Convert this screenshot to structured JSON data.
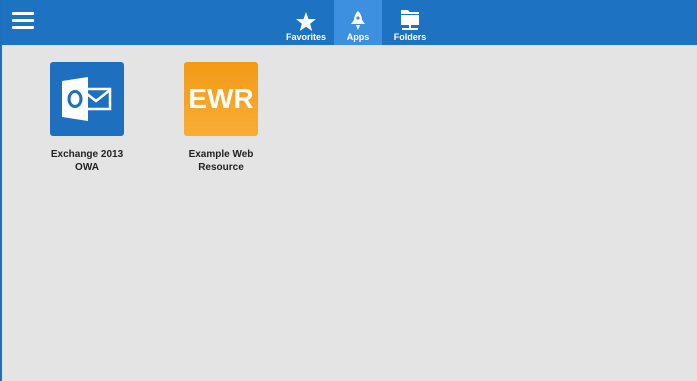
{
  "header": {
    "menu_icon": "hamburger-menu-icon",
    "tabs": [
      {
        "id": "favorites",
        "label": "Favorites",
        "icon": "star-icon",
        "active": false
      },
      {
        "id": "apps",
        "label": "Apps",
        "icon": "rocket-icon",
        "active": true
      },
      {
        "id": "folders",
        "label": "Folders",
        "icon": "folder-icon",
        "active": false
      }
    ]
  },
  "apps": [
    {
      "label_line1": "Exchange 2013",
      "label_line2": "OWA",
      "icon": "outlook-icon",
      "color": "#1f6fbf"
    },
    {
      "label_line1": "Example Web",
      "label_line2": "Resource",
      "icon_text": "EWR",
      "color": "#f49a16"
    }
  ],
  "colors": {
    "header": "#1d72c2",
    "active_tab": "#3d8fe0",
    "background": "#e4e4e4"
  }
}
